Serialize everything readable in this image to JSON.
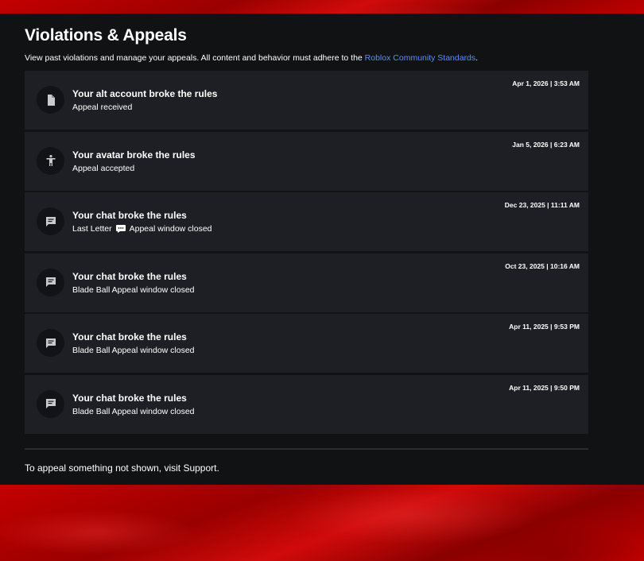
{
  "header": {
    "title": "Violations & Appeals",
    "subtitle_prefix": "View past violations and manage your appeals. All content and behavior must adhere to the",
    "subtitle_link": "Roblox Community Standards",
    "subtitle_suffix": "."
  },
  "violations": [
    {
      "icon": "document-icon",
      "title": "Your alt account broke the rules",
      "status": "Appeal received",
      "date": "Apr 1, 2026 | 3:53 AM"
    },
    {
      "icon": "avatar-icon",
      "title": "Your avatar broke the rules",
      "status": "Appeal accepted",
      "date": "Jan 5, 2026 | 6:23 AM"
    },
    {
      "icon": "chat-icon",
      "title": "Your chat broke the rules",
      "status_context": "Last Letter",
      "status": "Appeal window closed",
      "date": "Dec 23, 2025 | 11:11 AM"
    },
    {
      "icon": "chat-icon",
      "title": "Your chat broke the rules",
      "status": "Blade Ball Appeal window closed",
      "date": "Oct 23, 2025 | 10:16 AM"
    },
    {
      "icon": "chat-icon",
      "title": "Your chat broke the rules",
      "status": "Blade Ball Appeal window closed",
      "date": "Apr 11, 2025 | 9:53 PM"
    },
    {
      "icon": "chat-icon",
      "title": "Your chat broke the rules",
      "status": "Blade Ball Appeal window closed",
      "date": "Apr 11, 2025 | 9:50 PM"
    }
  ],
  "footer": {
    "text": "To appeal something not shown, visit Support."
  },
  "colors": {
    "panel_bg": "#111214",
    "card_bg": "#1d1f24",
    "link": "#5b8cff",
    "background_red": "#c40000"
  }
}
